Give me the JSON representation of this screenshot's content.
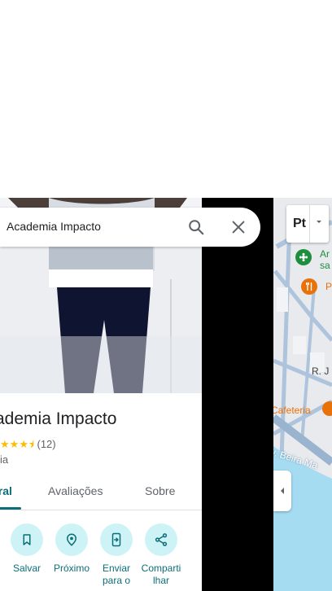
{
  "search": {
    "query": "Academia Impacto"
  },
  "place": {
    "name": "ademia Impacto",
    "rating_count": "(12)",
    "category": "ia",
    "rating": 4.5
  },
  "tabs": [
    {
      "label": "eral"
    },
    {
      "label": "Avaliações"
    },
    {
      "label": "Sobre"
    }
  ],
  "actions": [
    {
      "label": "Salvar",
      "icon": "bookmark-icon"
    },
    {
      "label": "Próximo",
      "icon": "nearby-icon"
    },
    {
      "label": "Enviar para o",
      "icon": "send-to-phone-icon"
    },
    {
      "label": "Comparti lhar",
      "icon": "share-icon"
    }
  ],
  "map": {
    "labels": {
      "poi_green": "Ar sa",
      "poi_orange": "P",
      "street_r": "R. J",
      "cafeteria": "Cafeteria",
      "beira_mar": "v. Beira Ma"
    },
    "layer_button_text": "Pt"
  },
  "colors": {
    "accent": "#0b6e78",
    "action_circle": "#cdf3f7",
    "star": "#fbbc04",
    "water": "#a5dcf2",
    "road": "#aec4dc",
    "poi_orange": "#e8710a",
    "poi_green": "#1e8e3e"
  }
}
